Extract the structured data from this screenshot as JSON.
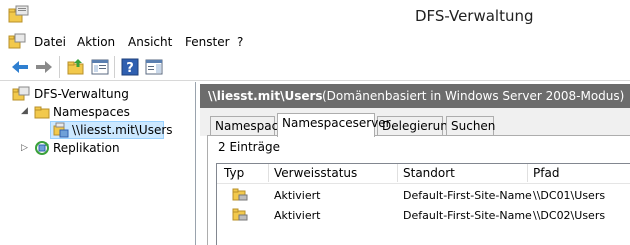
{
  "window": {
    "title": "DFS-Verwaltung"
  },
  "menu": {
    "items": [
      "Datei",
      "Aktion",
      "Ansicht",
      "Fenster",
      "?"
    ]
  },
  "toolbar": {
    "buttons": [
      "back-icon",
      "forward-icon",
      "folder-up-icon",
      "show-hide-tree-icon",
      "help-icon",
      "show-action-pane-icon"
    ]
  },
  "tree": {
    "root": "DFS-Verwaltung",
    "namespaces": "Namespaces",
    "namespace_item": "\\\\liesst.mit\\Users",
    "replication": "Replikation"
  },
  "panel": {
    "title": "\\\\liesst.mit\\Users",
    "subtitle": "(Domänenbasiert in Windows Server 2008-Modus)"
  },
  "tabs": [
    "Namespace",
    "Namespaceserver",
    "Delegierung",
    "Suchen"
  ],
  "active_tab": "Namespaceserver",
  "entry_count": "2 Einträge",
  "table": {
    "headers": [
      "Typ",
      "Verweisstatus",
      "Standort",
      "Pfad"
    ],
    "rows": [
      {
        "status": "Aktiviert",
        "site": "Default-First-Site-Name",
        "path": "\\\\DC01\\Users"
      },
      {
        "status": "Aktiviert",
        "site": "Default-First-Site-Name",
        "path": "\\\\DC02\\Users"
      }
    ]
  },
  "colors": {
    "header_bar": "#6c6c6c",
    "selection": "#cce8ff"
  }
}
